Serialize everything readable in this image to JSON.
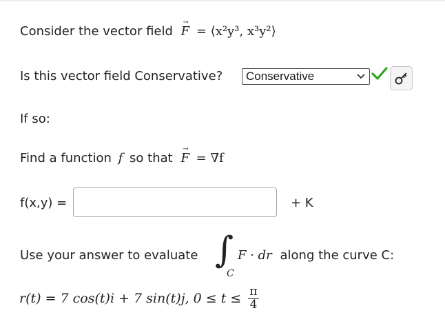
{
  "question": {
    "intro_text": "Consider the vector field",
    "field_name": "F",
    "field_definition": "= ⟨x²y³, x³y²⟩",
    "conservative_prompt": "Is this vector field Conservative?",
    "if_so_text": "If so:",
    "find_text_pre": "Find a function",
    "find_f": "f",
    "find_text_mid": "so that",
    "gradient_eq": "= ∇f",
    "function_label": "f(x,y) =",
    "constant_label": "+ K",
    "evaluate_text": "Use your answer to evaluate",
    "integral_sign": "∫",
    "integral_sub": "C",
    "integrand": "F · dr",
    "along_text": "along the curve C:",
    "curve": "r(t) = 7 cos(t)i + 7 sin(t)j,  0 ≤ t ≤",
    "upper_num": "π",
    "upper_den": "4"
  },
  "answer": {
    "select_value": "Conservative",
    "function_input_value": "",
    "function_input_placeholder": ""
  },
  "colors": {
    "check": "#2ea61c",
    "input_border": "#a7a7a7"
  },
  "icons": {
    "check": "checkmark-icon",
    "key": "key-icon",
    "chevron": "chevron-down-icon"
  }
}
